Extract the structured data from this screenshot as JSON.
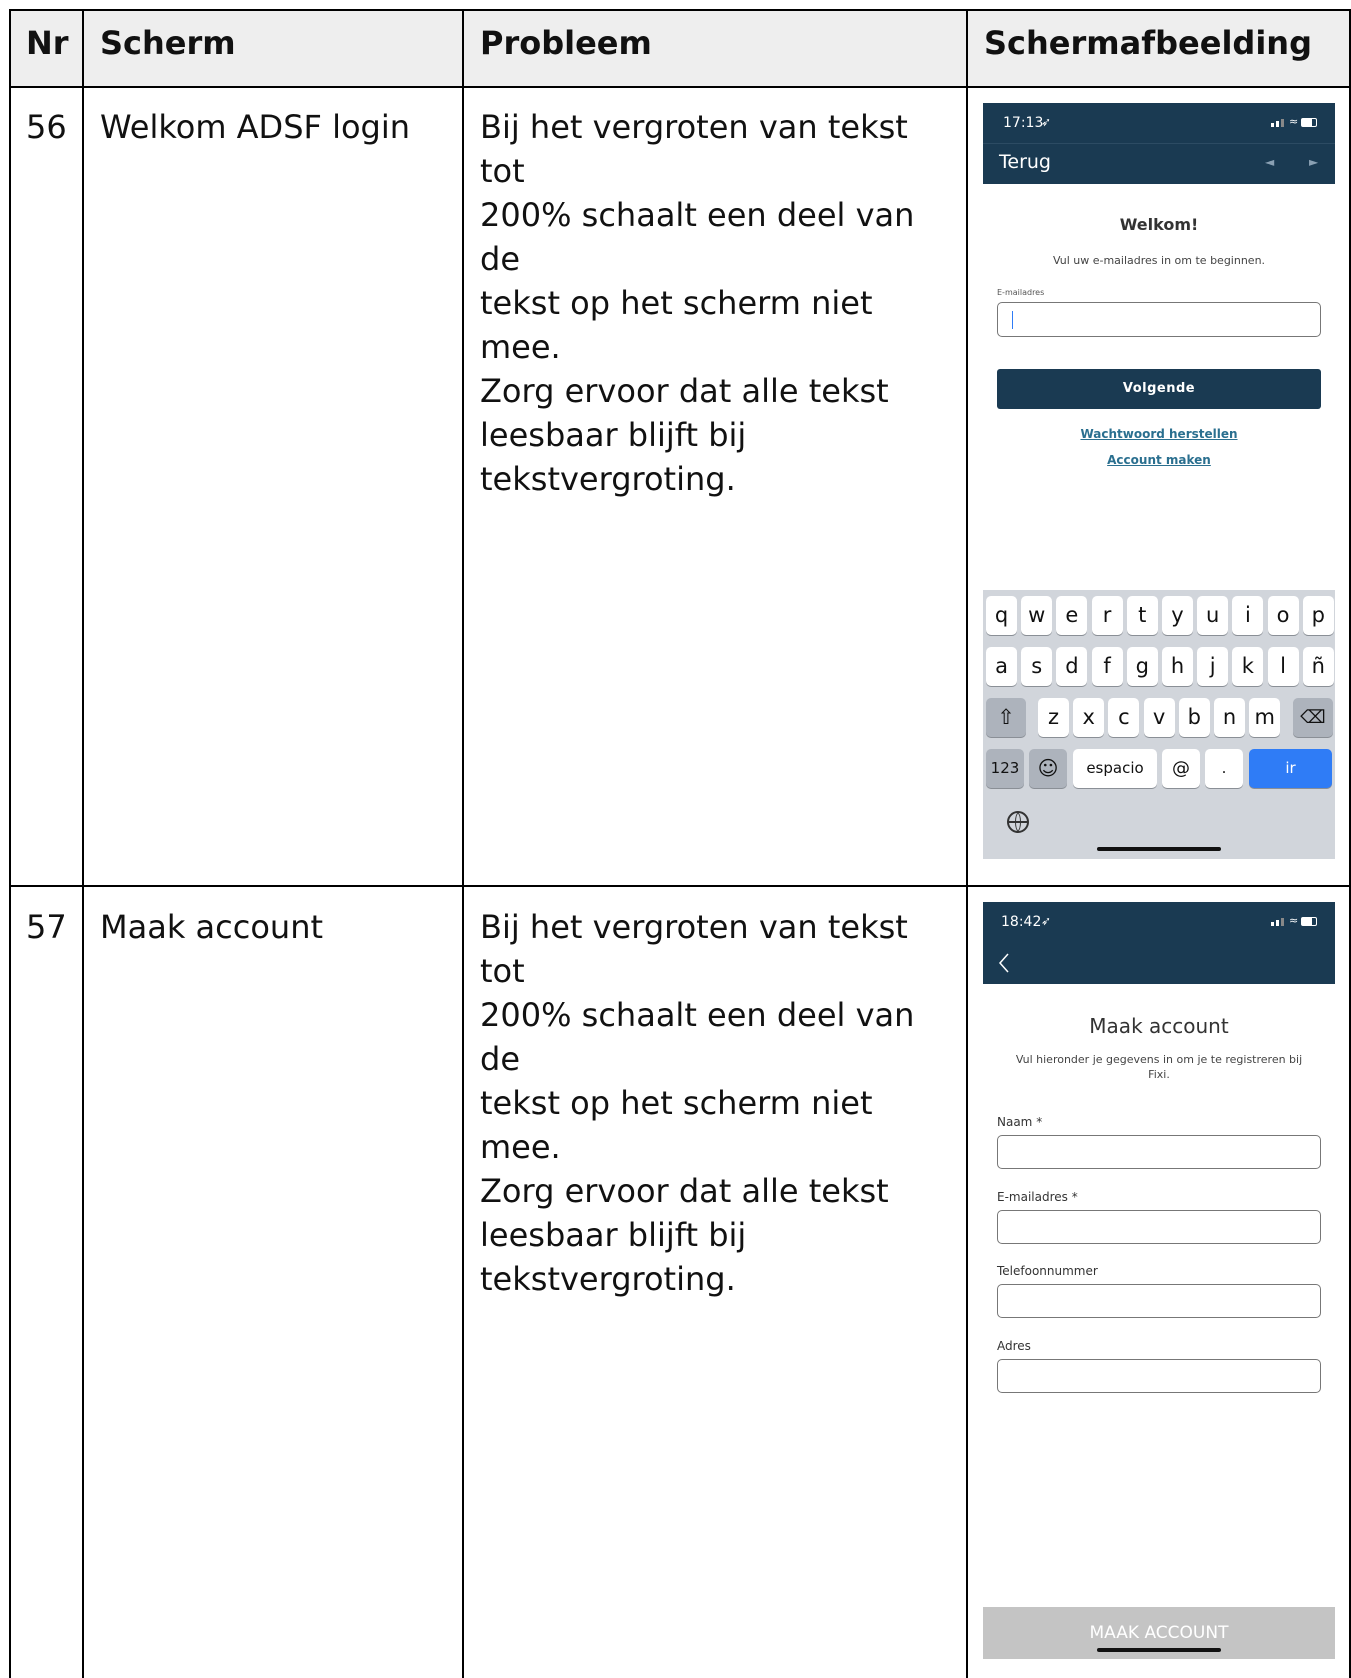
{
  "header": {
    "nr": "Nr",
    "scherm": "Scherm",
    "probleem": "Probleem",
    "schermafbeelding": "Schermafbeelding"
  },
  "rows": [
    {
      "nr": "56",
      "scherm": "Welkom ADSF login",
      "probleem": [
        "Bij het vergroten van tekst tot",
        "200% schaalt een deel van de",
        "tekst op het scherm niet mee.",
        "Zorg ervoor dat alle tekst",
        "leesbaar blijft bij",
        "tekstvergroting."
      ],
      "screenshot": {
        "time": "17:13",
        "nav_title": "Terug",
        "welcome": "Welkom!",
        "subtitle": "Vul uw e-mailadres in om te beginnen.",
        "field_label": "E-mailadres",
        "button": "Volgende",
        "link1": "Wachtwoord herstellen",
        "link2": "Account maken",
        "keyboard": {
          "row1": [
            "q",
            "w",
            "e",
            "r",
            "t",
            "y",
            "u",
            "i",
            "o",
            "p"
          ],
          "row2": [
            "a",
            "s",
            "d",
            "f",
            "g",
            "h",
            "j",
            "k",
            "l",
            "ñ"
          ],
          "row3": [
            "z",
            "x",
            "c",
            "v",
            "b",
            "n",
            "m"
          ],
          "numbers": "123",
          "space": "espacio",
          "at": "@",
          "dot": ".",
          "go": "ir"
        }
      }
    },
    {
      "nr": "57",
      "scherm": "Maak account",
      "probleem": [
        "Bij het vergroten van tekst tot",
        "200% schaalt een deel van de",
        "tekst op het scherm niet mee.",
        "Zorg ervoor dat alle tekst",
        "leesbaar blijft bij",
        "tekstvergroting."
      ],
      "screenshot": {
        "time": "18:42",
        "title": "Maak account",
        "subtitle_line1": "Vul hieronder je gegevens in om je te registreren bij",
        "subtitle_line2": "Fixi.",
        "fields": [
          "Naam *",
          "E-mailadres *",
          "Telefoonnummer",
          "Adres"
        ],
        "button": "MAAK ACCOUNT"
      }
    }
  ],
  "colors": {
    "app_header": "#1a3a52",
    "link": "#2a6f8f",
    "keyboard_bg": "#d1d5db",
    "go_key": "#2f7cf6"
  }
}
